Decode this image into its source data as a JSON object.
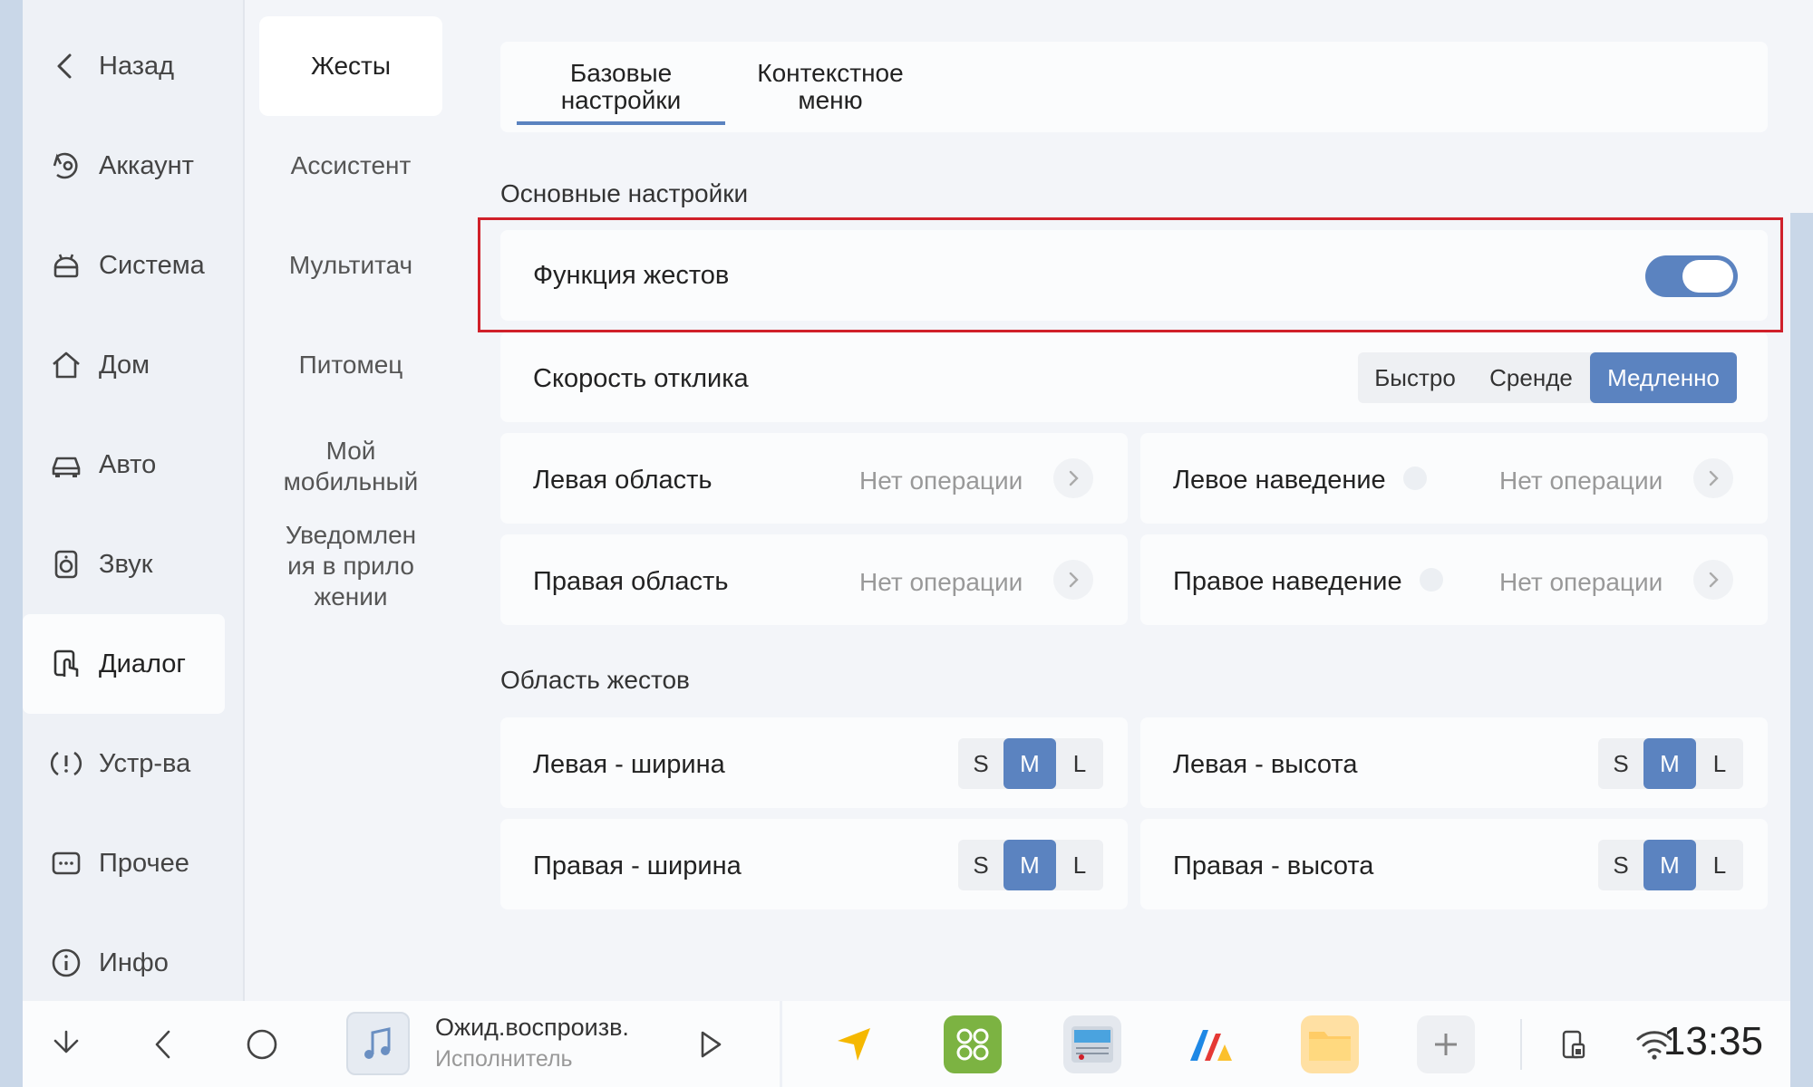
{
  "sidebar": {
    "back_label": "Назад",
    "items": [
      {
        "label": "Аккаунт",
        "icon": "account-icon"
      },
      {
        "label": "Система",
        "icon": "android-icon"
      },
      {
        "label": "Дом",
        "icon": "home-icon"
      },
      {
        "label": "Авто",
        "icon": "car-icon"
      },
      {
        "label": "Звук",
        "icon": "speaker-icon"
      },
      {
        "label": "Диалог",
        "icon": "touch-icon"
      },
      {
        "label": "Устр-ва",
        "icon": "devices-icon"
      },
      {
        "label": "Прочее",
        "icon": "more-icon"
      },
      {
        "label": "Инфо",
        "icon": "info-icon"
      }
    ],
    "active": "Диалог"
  },
  "subnav": {
    "items": [
      "Жесты",
      "Ассистент",
      "Мультитач",
      "Питомец",
      "Мой мобильный",
      "Уведомлен ия в прило жении"
    ],
    "active": "Жесты"
  },
  "tabs": {
    "basic": "Базовые настройки",
    "context": "Контекстное меню",
    "active": "Базовые настройки"
  },
  "main_settings": {
    "title": "Основные настройки",
    "gesture_function": {
      "label": "Функция жестов",
      "enabled": true
    },
    "response_speed": {
      "label": "Скорость отклика",
      "options": [
        "Быстро",
        "Сренде",
        "Медленно"
      ],
      "selected": "Медленно"
    },
    "left_area": {
      "label": "Левая область",
      "value": "Нет операции"
    },
    "left_hover": {
      "label": "Левое наведение",
      "value": "Нет операции"
    },
    "right_area": {
      "label": "Правая область",
      "value": "Нет операции"
    },
    "right_hover": {
      "label": "Правое наведение",
      "value": "Нет операции"
    }
  },
  "gesture_area": {
    "title": "Область жестов",
    "size_options": [
      "S",
      "M",
      "L"
    ],
    "left_width": {
      "label": "Левая - ширина",
      "selected": "M"
    },
    "left_height": {
      "label": "Левая - высота",
      "selected": "M"
    },
    "right_width": {
      "label": "Правая - ширина",
      "selected": "M"
    },
    "right_height": {
      "label": "Правая - высота",
      "selected": "M"
    }
  },
  "taskbar": {
    "now_playing_title": "Ожид.воспроизв.",
    "now_playing_artist": "Исполнитель",
    "clock": "13:35",
    "accent": "#5b83c0"
  }
}
